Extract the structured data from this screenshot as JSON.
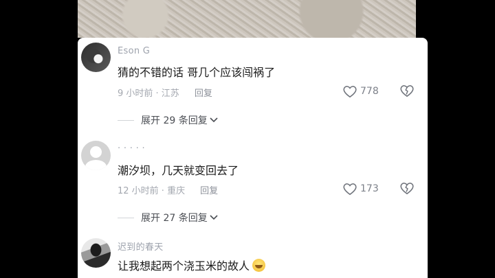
{
  "comments": [
    {
      "username": "Eson G",
      "text": "猜的不错的话 哥几个应该闯祸了",
      "time_location": "9 小时前 · 江苏",
      "reply_label": "回复",
      "likes": "778",
      "expand_label": "展开 29 条回复"
    },
    {
      "username": "· · · · ·",
      "text": "潮汐坝，几天就变回去了",
      "time_location": "12 小时前 · 重庆",
      "reply_label": "回复",
      "likes": "173",
      "expand_label": "展开 27 条回复"
    },
    {
      "username": "迟到的春天",
      "text": "让我想起两个浇玉米的故人",
      "emoji": "grin-emoji"
    }
  ],
  "icons": {
    "like": "heart-outline-icon",
    "dislike": "broken-heart-icon",
    "expand": "chevron-down-icon"
  },
  "colors": {
    "background": "#000000",
    "panel": "#ffffff",
    "username": "#9ea3ad",
    "meta": "#a3a7af",
    "text": "#1b1b1b"
  }
}
